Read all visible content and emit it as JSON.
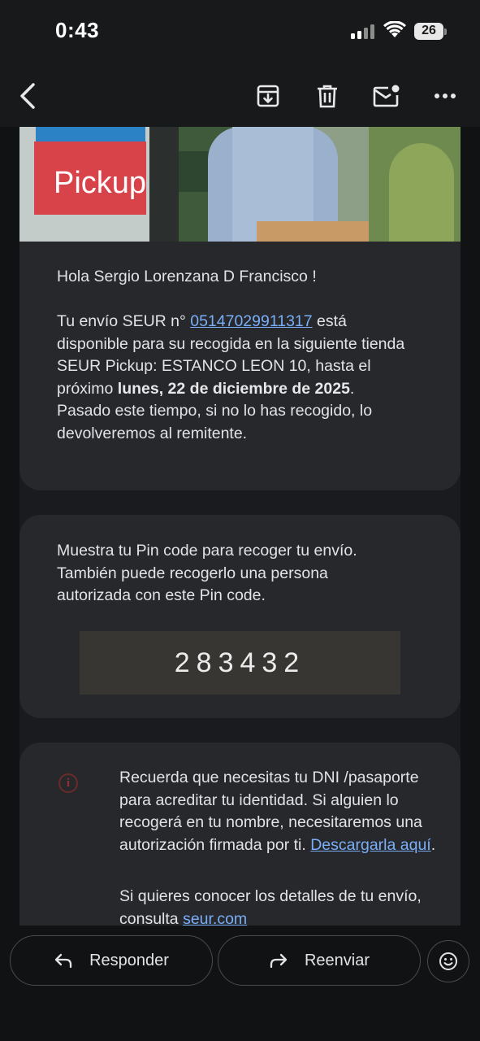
{
  "status": {
    "time": "0:43",
    "battery": "26"
  },
  "toolbar": {
    "back": "chevron-left-icon",
    "archive": "archive-icon",
    "delete": "trash-icon",
    "mark_unread": "mail-unread-icon",
    "more": "more-horizontal-icon"
  },
  "hero": {
    "sign_text": "Pickup"
  },
  "email": {
    "greeting": "Hola Sergio Lorenzana D Francisco !",
    "shipment_pre": "Tu envío SEUR n° ",
    "tracking_number": "05147029911317",
    "shipment_post": " está disponible para su recogida en la siguiente tienda SEUR Pickup: ESTANCO LEON 10, hasta el próximo ",
    "deadline": "lunes, 22 de diciembre de 2025",
    "shipment_end": ".",
    "return_notice": "Pasado este tiempo, si no lo has recogido, lo devolveremos al remitente.",
    "pin_intro": "Muestra tu Pin code para recoger tu envío. También puede recogerlo una persona autorizada con este Pin code.",
    "pin_code": "283432",
    "id_notice": "Recuerda que necesitas tu DNI /pasaporte para acreditar tu identidad. Si alguien lo recogerá en tu nombre, necesitaremos una autorización firmada por ti. ",
    "download_link": "Descargarla aquí",
    "id_notice_end": ".",
    "details_pre": "Si quieres conocer los detalles de tu envío, consulta ",
    "details_link": "seur.com"
  },
  "actions": {
    "reply": "Responder",
    "forward": "Reenviar",
    "emoji": "emoji-icon"
  },
  "colors": {
    "link": "#7aaef7",
    "background": "#111214",
    "card": "#27282c",
    "pin_box": "#383633"
  }
}
